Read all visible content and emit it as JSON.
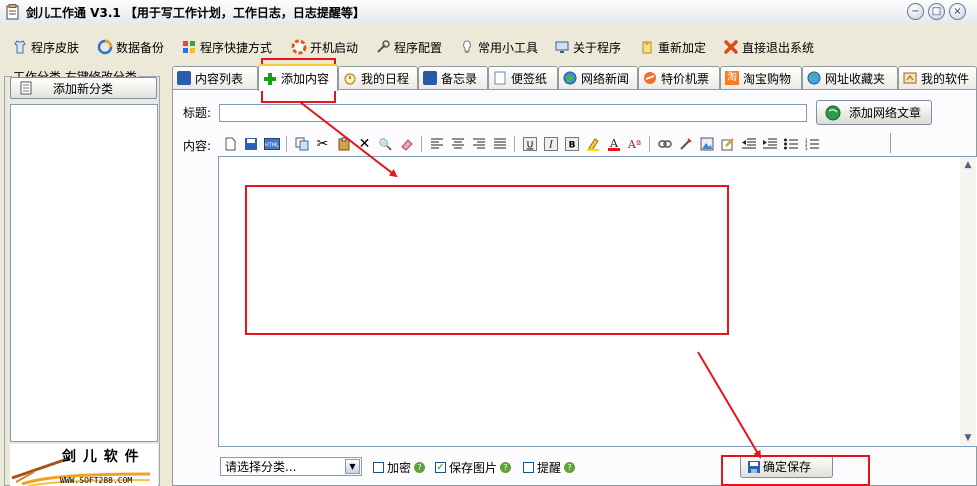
{
  "window": {
    "title": "剑儿工作通 V3.1 【用于写工作计划，工作日志，日志提醒等】"
  },
  "menu": {
    "items": [
      {
        "label": "程序皮肤",
        "icon": "skin-icon"
      },
      {
        "label": "数据备份",
        "icon": "backup-icon"
      },
      {
        "label": "程序快捷方式",
        "icon": "shortcut-icon"
      },
      {
        "label": "开机启动",
        "icon": "startup-icon"
      },
      {
        "label": "程序配置",
        "icon": "config-icon"
      },
      {
        "label": "常用小工具",
        "icon": "tools-icon"
      },
      {
        "label": "关于程序",
        "icon": "about-icon"
      },
      {
        "label": "重新加定",
        "icon": "reload-icon"
      },
      {
        "label": "直接退出系统",
        "icon": "exit-icon"
      }
    ]
  },
  "sidebar": {
    "group_label": "工作分类,右键修改分类",
    "add_button": "添加新分类",
    "logo_text": "剑 儿 软 件",
    "logo_url": "WWW.SOFT288.COM"
  },
  "tabs": [
    {
      "label": "内容列表"
    },
    {
      "label": "添加内容",
      "active": true
    },
    {
      "label": "我的日程"
    },
    {
      "label": "备忘录"
    },
    {
      "label": "便签纸"
    },
    {
      "label": "网络新闻"
    },
    {
      "label": "特价机票"
    },
    {
      "label": "淘宝购物"
    },
    {
      "label": "网址收藏夹"
    },
    {
      "label": "我的软件"
    }
  ],
  "form": {
    "title_label": "标题:",
    "title_value": "",
    "add_web_button": "添加网络文章",
    "content_label": "内容:",
    "category_select": "请选择分类...",
    "encrypt_label": "加密",
    "encrypt_checked": false,
    "save_images_label": "保存图片",
    "save_images_checked": true,
    "remind_label": "提醒",
    "remind_checked": false,
    "save_button": "确定保存"
  },
  "toolbar_icons": [
    "new-doc-icon",
    "save-icon",
    "html-icon",
    "copy-icon",
    "cut-icon",
    "paste-icon",
    "delete-icon",
    "find-icon",
    "eraser-icon",
    "align-left-icon",
    "align-center-icon",
    "align-right-icon",
    "align-justify-icon",
    "underline-icon",
    "italic-icon",
    "bold-icon",
    "highlight-icon",
    "font-color-icon",
    "font-size-icon",
    "link-icon",
    "unlink-icon",
    "image-icon",
    "edit-icon",
    "outdent-icon",
    "indent-icon",
    "bullet-list-icon",
    "numbered-list-icon"
  ],
  "colors": {
    "accent_red": "#e8141b",
    "active_tab_top": "#ffc83c",
    "window_bg": "#ece9d8"
  }
}
